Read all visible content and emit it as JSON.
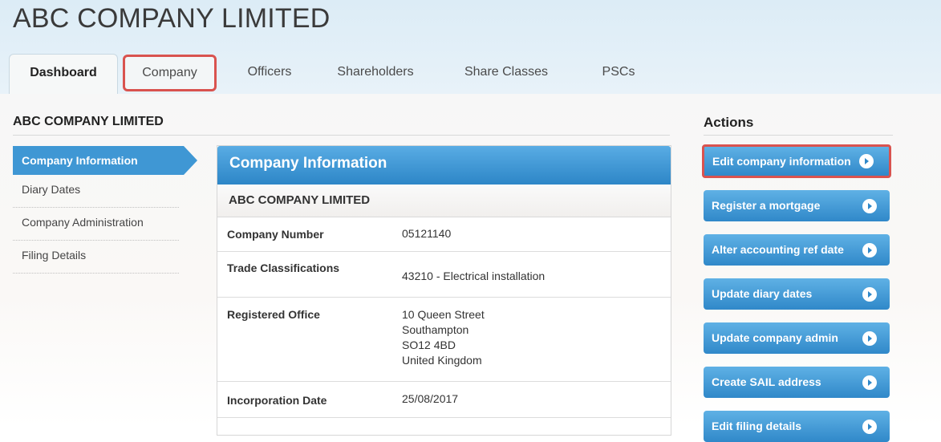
{
  "header": {
    "company_title": "ABC COMPANY LIMITED"
  },
  "tabs": [
    {
      "label": "Dashboard"
    },
    {
      "label": "Company"
    },
    {
      "label": "Officers"
    },
    {
      "label": "Shareholders"
    },
    {
      "label": "Share Classes"
    },
    {
      "label": "PSCs"
    }
  ],
  "section": {
    "title": "ABC COMPANY LIMITED"
  },
  "sidenav": [
    {
      "label": "Company Information"
    },
    {
      "label": "Diary Dates"
    },
    {
      "label": "Company Administration"
    },
    {
      "label": "Filing Details"
    }
  ],
  "panel": {
    "title": "Company Information",
    "subtitle": "ABC COMPANY LIMITED",
    "rows": [
      {
        "label": "Company Number",
        "value": "05121140"
      },
      {
        "label": "Trade Classifications",
        "value": "43210 - Electrical installation"
      },
      {
        "label": "Registered Office",
        "lines": [
          "10 Queen Street",
          "Southampton",
          "SO12 4BD",
          "United Kingdom"
        ]
      },
      {
        "label": "Incorporation Date",
        "value": "25/08/2017"
      }
    ]
  },
  "actions": {
    "title": "Actions",
    "buttons": [
      {
        "label": "Edit company information"
      },
      {
        "label": "Register a mortgage"
      },
      {
        "label": "Alter accounting ref date"
      },
      {
        "label": "Update diary dates"
      },
      {
        "label": "Update company admin"
      },
      {
        "label": "Create SAIL address"
      },
      {
        "label": "Edit filing details"
      }
    ]
  },
  "colors": {
    "accent": "#3f97d4",
    "highlight": "#d9534f"
  }
}
